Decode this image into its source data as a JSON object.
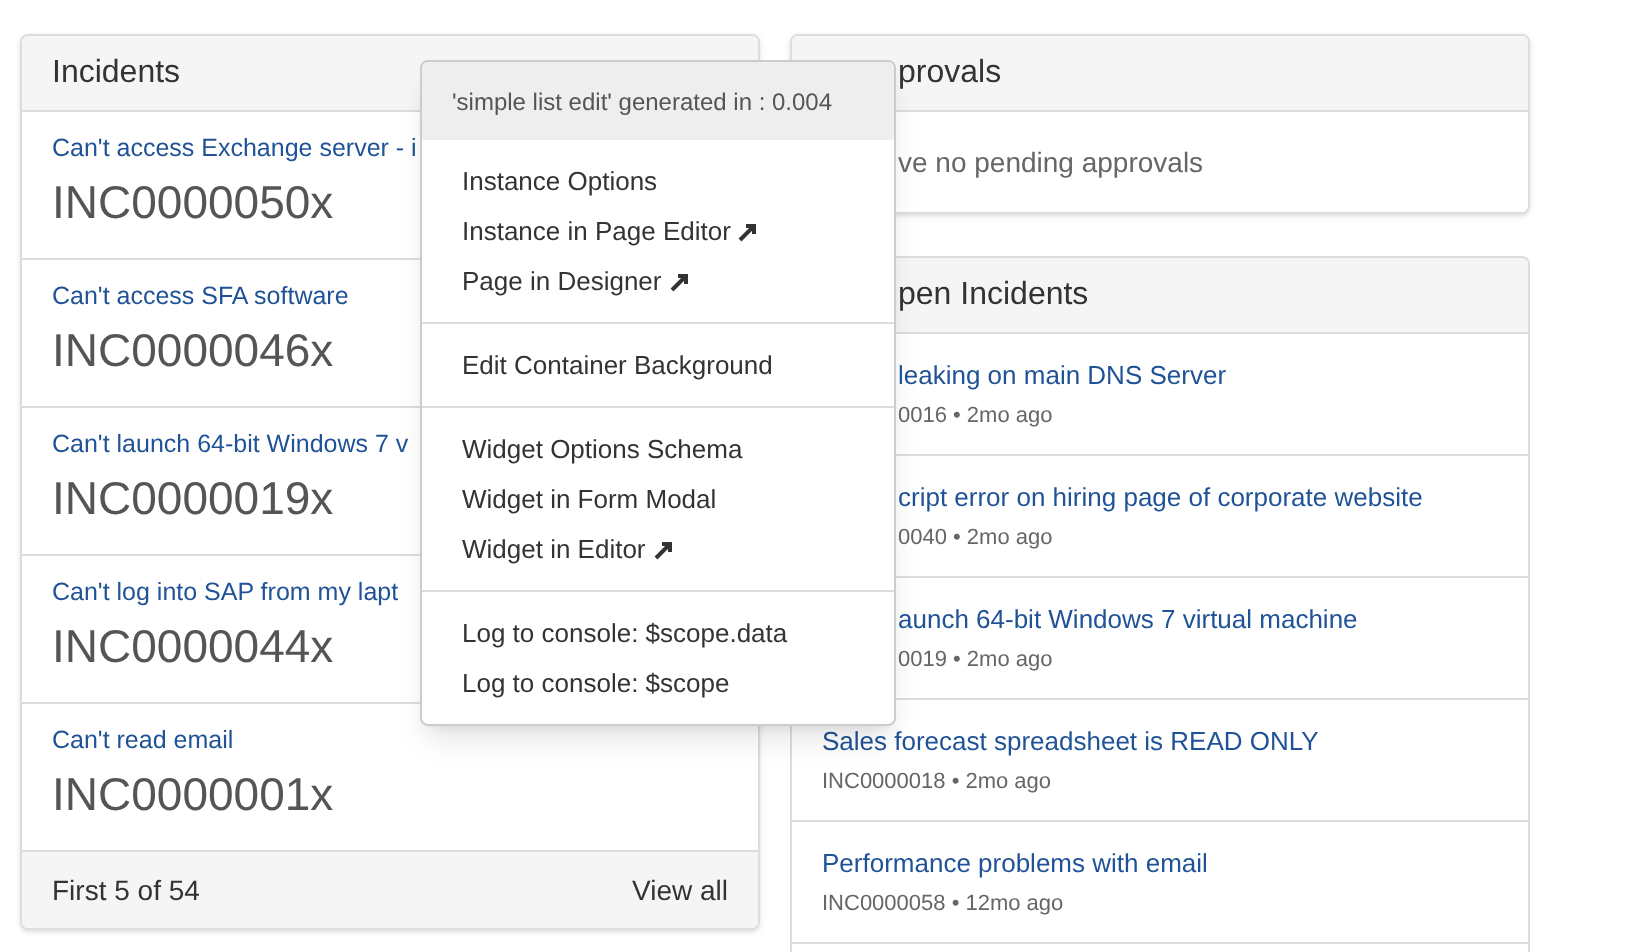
{
  "incidents_panel": {
    "title": "Incidents",
    "rows": [
      {
        "link": "Can't access Exchange server - i",
        "number": "INC0000050x"
      },
      {
        "link": "Can't access SFA software",
        "number": "INC0000046x"
      },
      {
        "link": "Can't launch 64-bit Windows 7 v",
        "number": "INC0000019x"
      },
      {
        "link": "Can't log into SAP from my lapt",
        "number": "INC0000044x"
      },
      {
        "link": "Can't read email",
        "number": "INC0000001x"
      }
    ],
    "footer": {
      "count": "First 5 of 54",
      "view_all": "View all"
    }
  },
  "approvals_panel": {
    "title": "provals",
    "message": "ve no pending approvals"
  },
  "open_incidents_panel": {
    "title": "pen Incidents",
    "rows": [
      {
        "link": "leaking on main DNS Server",
        "meta": "0016 • 2mo ago"
      },
      {
        "link": "cript error on hiring page of corporate website",
        "meta": "0040 • 2mo ago"
      },
      {
        "link": "aunch 64-bit Windows 7 virtual machine",
        "meta": "0019 • 2mo ago"
      },
      {
        "link": "Sales forecast spreadsheet is READ ONLY",
        "meta": "INC0000018 • 2mo ago"
      },
      {
        "link": "Performance problems with email",
        "meta": "INC0000058 • 12mo ago"
      }
    ]
  },
  "context_menu": {
    "header": "'simple list edit' generated in : 0.004",
    "groups": [
      [
        {
          "label": "Instance Options",
          "external": false
        },
        {
          "label": "Instance in Page Editor",
          "external": true
        },
        {
          "label": "Page in Designer",
          "external": true
        }
      ],
      [
        {
          "label": "Edit Container Background",
          "external": false
        }
      ],
      [
        {
          "label": "Widget Options Schema",
          "external": false
        },
        {
          "label": "Widget in Form Modal",
          "external": false
        },
        {
          "label": "Widget in Editor",
          "external": true
        }
      ],
      [
        {
          "label": "Log to console: $scope.data",
          "external": false
        },
        {
          "label": "Log to console: $scope",
          "external": false
        }
      ]
    ]
  }
}
